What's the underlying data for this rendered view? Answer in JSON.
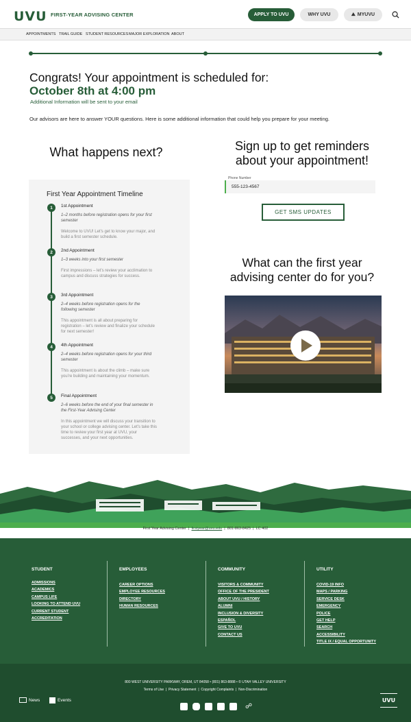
{
  "header": {
    "logo": "UVU",
    "site_title": "FIRST-YEAR ADVISING CENTER",
    "apply": "APPLY TO UVU",
    "why": "WHY UVU",
    "myuvu": "MYUVU"
  },
  "subnav": [
    "APPOINTMENTS",
    "TRAIL GUIDE",
    "STUDENT RESOURCES",
    "MAJOR EXPLORATION",
    "ABOUT"
  ],
  "confirm": {
    "congrats": "Congrats! Your appointment is scheduled for:",
    "date": "October 8th at 4:00 pm",
    "additional": "Additional Information will be sent to your email",
    "intro": "Our advisors are here to answer YOUR questions. Here is some additional information that could help you prepare for your meeting."
  },
  "next": {
    "heading": "What happens next?",
    "timeline_title": "First Year Appointment Timeline",
    "steps": [
      {
        "num": "1",
        "title": "1st Appointment",
        "when": "1–2 months before registration opens for your first semester",
        "desc": "Welcome to UVU! Let’s get to know your major, and build a first semester schedule."
      },
      {
        "num": "2",
        "title": "2nd Appointment",
        "when": "1–3 weeks into your first semester",
        "desc": "First impressions – let’s review your acclimation to campus and discuss strategies for success."
      },
      {
        "num": "3",
        "title": "3rd Appointment",
        "when": "2–4 weeks before registration opens for the following semester",
        "desc": "This appointment is all about preparing for registration – let’s review and finalize your schedule for next semester!"
      },
      {
        "num": "4",
        "title": "4th Appointment",
        "when": "2–4 weeks before registration opens for your third semester",
        "desc": "This appointment is about the climb – make sure you’re building and maintaining your momentum."
      },
      {
        "num": "5",
        "title": "Final Appointment",
        "when": "2–6 weeks before the end of your final semester in the First-Year Advising Center",
        "desc": "In this appointment we will discuss your transition to your school or college advising center. Let’s take this time to review your first year at UVU, your successes, and your next opportunities."
      }
    ]
  },
  "sms": {
    "heading": "Sign up to get reminders about your appointment!",
    "phone_label": "Phone Number",
    "phone_value": "555-123-4567",
    "button": "GET SMS UPDATES"
  },
  "video": {
    "heading": "What can the first year advising center do for you?"
  },
  "contact": {
    "name": "First Year Advising Center",
    "email": "firstyear@uvu.edu",
    "phone": "801-863-8425",
    "room": "LC 402"
  },
  "footer": {
    "columns": [
      {
        "heading": "STUDENT",
        "links": [
          "ADMISSIONS",
          "ACADEMICS",
          "CAMPUS LIFE",
          "LOOKING TO ATTEND UVU",
          "CURRENT STUDENT",
          "ACCREDITATION"
        ]
      },
      {
        "heading": "EMPLOYEES",
        "links": [
          "CAREER OPTIONS",
          "EMPLOYEE RESOURCES",
          "DIRECTORY",
          "HUMAN RESOURCES"
        ]
      },
      {
        "heading": "COMMUNITY",
        "links": [
          "VISITORS & COMMUNITY",
          "OFFICE OF THE PRESIDENT",
          "ABOUT UVU / HISTORY",
          "ALUMNI",
          "INCLUSION & DIVERSITY",
          "ESPAÑOL",
          "GIVE TO UVU",
          "CONTACT US"
        ]
      },
      {
        "heading": "UTILITY",
        "links": [
          "COVID-19 INFO",
          "MAPS / PARKING",
          "SERVICE DESK",
          "EMERGENCY",
          "POLICE",
          "GET HELP",
          "SEARCH",
          "ACCESSIBILITY",
          "TITLE IX / EQUAL OPPORTUNITY"
        ]
      }
    ],
    "address": "800 WEST UNIVERSITY PARKWAY, OREM, UT 84058 • (801) 863-8888 • © UTAH VALLEY UNIVERSITY",
    "legal": [
      "Terms of Use",
      "Privacy Statement",
      "Copyright Complaints",
      "Non-Discrimination"
    ],
    "news": "News",
    "events": "Events",
    "logo": "UVU"
  }
}
